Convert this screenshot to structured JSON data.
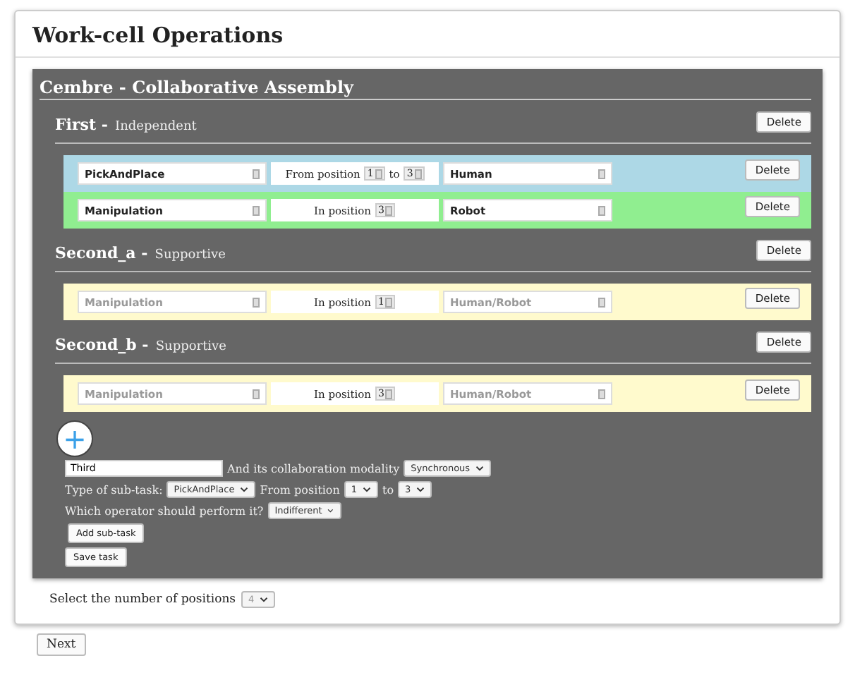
{
  "page": {
    "title": "Work-cell Operations"
  },
  "panel": {
    "title": "Cembre - Collaborative Assembly",
    "tasks": [
      {
        "name": "First -",
        "modality": "Independent",
        "delete": "Delete",
        "subtasks": [
          {
            "kind": "range",
            "color": "#add8e6",
            "disabled": false,
            "type": "PickAndPlace",
            "label": "From position",
            "from": "1",
            "to_label": "to",
            "to": "3",
            "operator": "Human",
            "delete": "Delete"
          },
          {
            "kind": "single",
            "color": "#90ee90",
            "disabled": false,
            "type": "Manipulation",
            "label": "In position",
            "from": "3",
            "operator": "Robot",
            "delete": "Delete"
          }
        ]
      },
      {
        "name": "Second_a -",
        "modality": "Supportive",
        "delete": "Delete",
        "subtasks": [
          {
            "kind": "single",
            "color": "#fffacd",
            "disabled": true,
            "type": "Manipulation",
            "label": "In position",
            "from": "1",
            "operator": "Human/Robot",
            "delete": "Delete"
          }
        ]
      },
      {
        "name": "Second_b -",
        "modality": "Supportive",
        "delete": "Delete",
        "subtasks": [
          {
            "kind": "single",
            "color": "#fffacd",
            "disabled": true,
            "type": "Manipulation",
            "label": "In position",
            "from": "3",
            "operator": "Human/Robot",
            "delete": "Delete"
          }
        ]
      }
    ],
    "add_icon": "+",
    "form": {
      "name_value": "Third",
      "modality_label": "And its collaboration modality",
      "modality": "Synchronous",
      "type_label": "Type of sub-task:",
      "type": "PickAndPlace",
      "from_label": "From position",
      "from": "1",
      "to_label": "to",
      "to": "3",
      "operator_label": "Which operator should perform it?",
      "operator": "Indifferent",
      "add_subtask": "Add sub-task",
      "save_task": "Save task"
    }
  },
  "positions": {
    "label": "Select the number of positions",
    "value": "4",
    "disabled": true
  },
  "next": "Next"
}
